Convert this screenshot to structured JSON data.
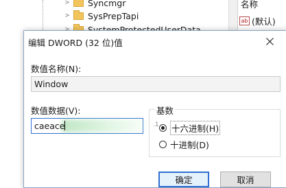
{
  "background": {
    "tree_items": [
      {
        "label": "Syncmgr"
      },
      {
        "label": "SysPrepTapi"
      },
      {
        "label": "SystemProtectedUserData"
      }
    ],
    "values_pane": {
      "column_header": "名称",
      "rows": [
        {
          "icon": "string-value-icon",
          "label": "(默认)"
        }
      ]
    }
  },
  "dialog": {
    "title": "编辑 DWORD (32 位)值",
    "value_name_label": "数值名称(N):",
    "value_name": "Window",
    "value_data_label": "数值数据(V):",
    "value_data": "caeace",
    "base_group": {
      "title": "基数",
      "options": [
        {
          "label": "十六进制(H)",
          "checked": true
        },
        {
          "label": "十进制(D)",
          "checked": false
        }
      ]
    },
    "ok_label": "确定",
    "cancel_label": "取消"
  },
  "colors": {
    "accent": "#2f6fd1",
    "folder": "#f2c55c"
  }
}
